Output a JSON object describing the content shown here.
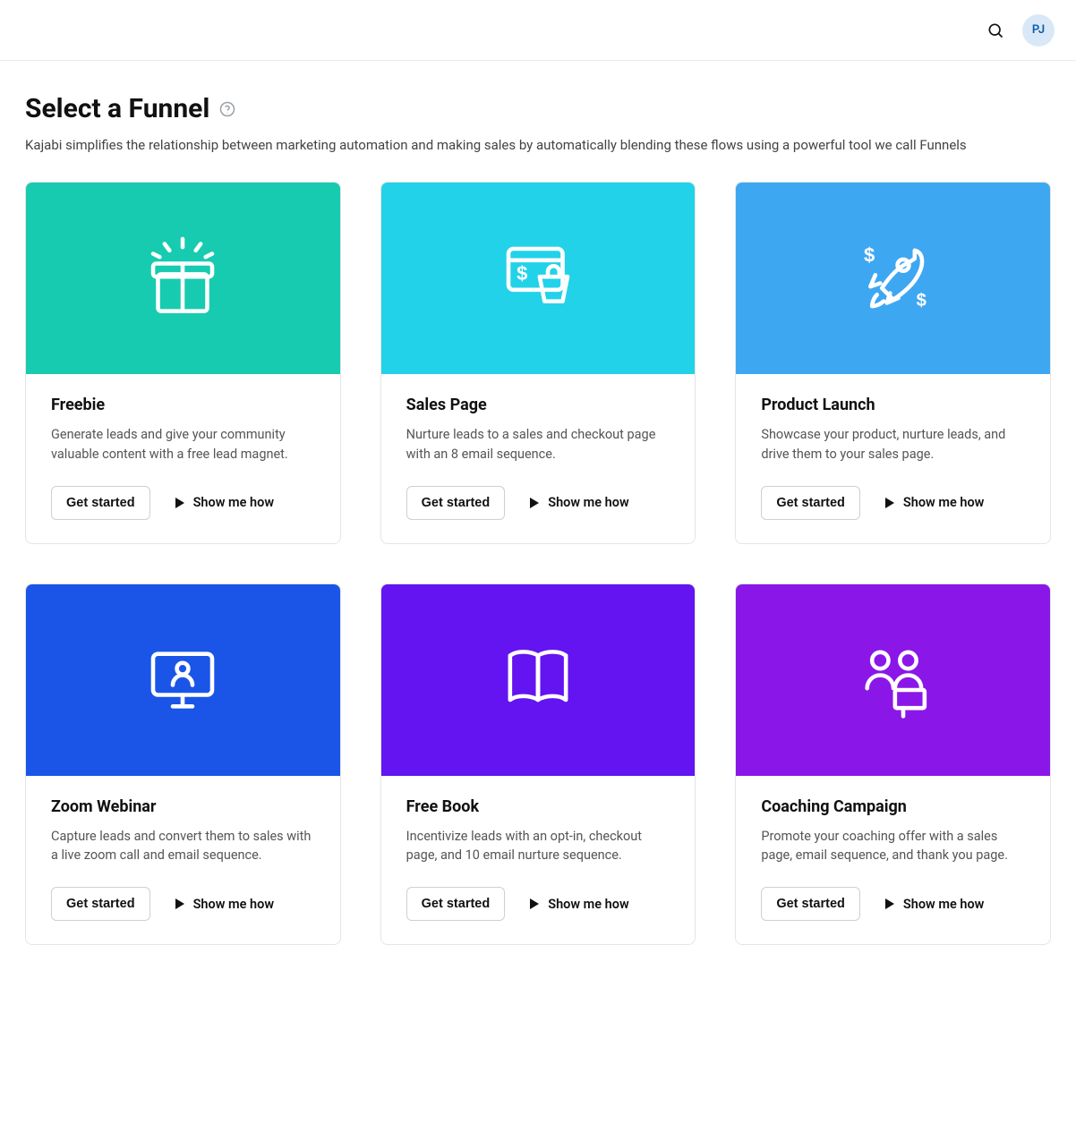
{
  "header": {
    "avatar_initials": "PJ"
  },
  "page": {
    "title": "Select a Funnel",
    "subtitle": "Kajabi simplifies the relationship between marketing automation and making sales by automatically blending these flows using a powerful tool we call Funnels"
  },
  "labels": {
    "get_started": "Get started",
    "show_me_how": "Show me how"
  },
  "funnels": [
    {
      "icon": "gift-icon",
      "hero_class": "hero-teal",
      "title": "Freebie",
      "desc": "Generate leads and give your community valuable content with a free lead magnet."
    },
    {
      "icon": "sales-page-icon",
      "hero_class": "hero-cyan",
      "title": "Sales Page",
      "desc": "Nurture leads to a sales and checkout page with an 8 email sequence."
    },
    {
      "icon": "rocket-money-icon",
      "hero_class": "hero-sky",
      "title": "Product Launch",
      "desc": "Showcase your product, nurture leads, and drive them to your sales page."
    },
    {
      "icon": "webinar-icon",
      "hero_class": "hero-blue",
      "title": "Zoom Webinar",
      "desc": "Capture leads and convert them to sales with a live zoom call and email sequence."
    },
    {
      "icon": "book-icon",
      "hero_class": "hero-indigo",
      "title": "Free Book",
      "desc": "Incentivize leads with an opt-in, checkout page, and 10 email nurture sequence."
    },
    {
      "icon": "coaching-icon",
      "hero_class": "hero-purple",
      "title": "Coaching Campaign",
      "desc": "Promote your coaching offer with a sales page, email sequence, and thank you page."
    }
  ]
}
